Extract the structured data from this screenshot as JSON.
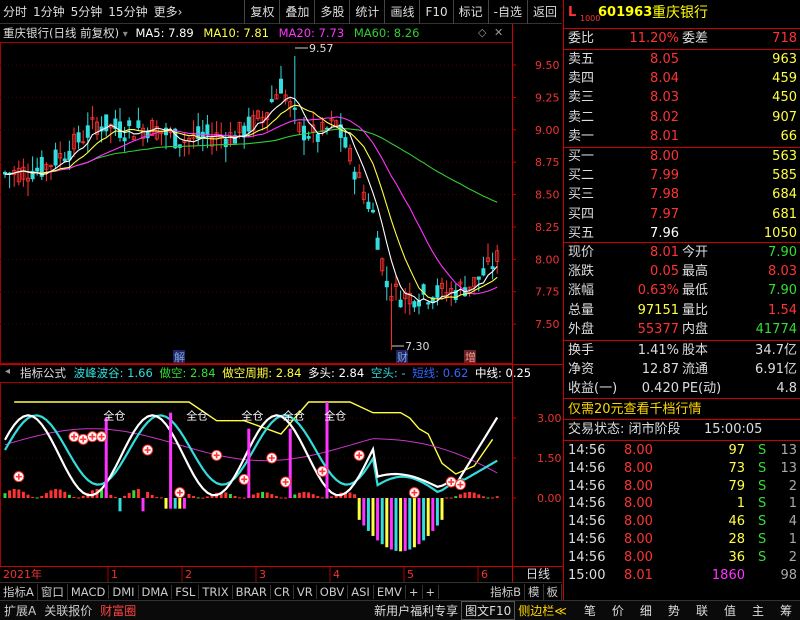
{
  "toolbar": {
    "left": [
      "分时",
      "1分钟",
      "5分钟",
      "15分钟",
      "更多›"
    ],
    "right": [
      "复权",
      "叠加",
      "多股",
      "统计",
      "画线",
      "F10",
      "标记",
      "-自选",
      "返回"
    ]
  },
  "main_legend": {
    "title": "重庆银行(日线 前复权)",
    "ma5": "MA5: 7.89",
    "ma10": "MA10: 7.81",
    "ma20": "MA20: 7.73",
    "ma60": "MA60: 8.26"
  },
  "markers": {
    "high": "9.57",
    "low": "7.30",
    "jie": "解",
    "cai": "财",
    "zeng": "增",
    "cang": "仓",
    "full_cang": "全仓"
  },
  "ind_legend": {
    "name": "指标公式",
    "p1": "波峰波谷: 1.66",
    "p2": "做空: 2.84",
    "p3": "做空周期: 2.84",
    "p4": "多头: 2.84",
    "p5": "空头: -",
    "p6": "短线: 0.62",
    "p7": "中线: 0.25"
  },
  "axis": {
    "main": [
      "9.50",
      "9.25",
      "9.00",
      "8.75",
      "8.50",
      "8.25",
      "8.00",
      "7.75",
      "7.50"
    ],
    "ind": [
      "3.00",
      "1.50",
      "0.00"
    ]
  },
  "time_axis": {
    "year": "2021年",
    "months": [
      "1",
      "2",
      "3",
      "4",
      "5",
      "6"
    ],
    "label": "日线"
  },
  "tabs": [
    "指标A",
    "窗口",
    "MACD",
    "DMI",
    "DMA",
    "FSL",
    "TRIX",
    "BRAR",
    "CR",
    "VR",
    "OBV",
    "ASI",
    "EMV",
    "+",
    "+"
  ],
  "tabs_right": [
    "指标B",
    "模",
    "板"
  ],
  "bottom_left": [
    "扩展A",
    "关联报价",
    "财富圈"
  ],
  "bottom_mid": [
    "新用户福利专享",
    "图文F10",
    "侧边栏≪"
  ],
  "bottom_right": [
    "笔",
    "价",
    "细",
    "势",
    "联",
    "值",
    "主",
    "筹"
  ],
  "stock": {
    "prefix": "L",
    "code": "601963",
    "name": "重庆银行"
  },
  "order_book": {
    "ratio": {
      "l1": "委比",
      "v1": "11.20%",
      "l2": "委差",
      "v2": "718"
    },
    "asks": [
      {
        "l": "卖五",
        "p": "8.05",
        "v": "963"
      },
      {
        "l": "卖四",
        "p": "8.04",
        "v": "459"
      },
      {
        "l": "卖三",
        "p": "8.03",
        "v": "450"
      },
      {
        "l": "卖二",
        "p": "8.02",
        "v": "907"
      },
      {
        "l": "卖一",
        "p": "8.01",
        "v": "66"
      }
    ],
    "bids": [
      {
        "l": "买一",
        "p": "8.00",
        "v": "563"
      },
      {
        "l": "买二",
        "p": "7.99",
        "v": "585"
      },
      {
        "l": "买三",
        "p": "7.98",
        "v": "684"
      },
      {
        "l": "买四",
        "p": "7.97",
        "v": "681"
      },
      {
        "l": "买五",
        "p": "7.96",
        "v": "1050"
      }
    ]
  },
  "quote": [
    {
      "l1": "现价",
      "v1": "8.01",
      "l2": "今开",
      "v2": "7.90"
    },
    {
      "l1": "涨跌",
      "v1": "0.05",
      "l2": "最高",
      "v2": "8.03"
    },
    {
      "l1": "涨幅",
      "v1": "0.63%",
      "l2": "最低",
      "v2": "7.90"
    },
    {
      "l1": "总量",
      "v1": "97151",
      "l2": "量比",
      "v2": "1.54"
    },
    {
      "l1": "外盘",
      "v1": "55377",
      "l2": "内盘",
      "v2": "41774"
    }
  ],
  "stats": [
    {
      "l1": "换手",
      "v1": "1.41%",
      "l2": "股本",
      "v2": "34.7亿"
    },
    {
      "l1": "净资",
      "v1": "12.87",
      "l2": "流通",
      "v2": "6.91亿"
    },
    {
      "l1": "收益(一)",
      "v1": "0.420",
      "l2": "PE(动)",
      "v2": "4.8"
    }
  ],
  "promo": "仅需20元查看千档行情",
  "trade_state": {
    "label": "交易状态: 闭市阶段",
    "time": "15:00:05"
  },
  "ticks": [
    {
      "t": "14:56",
      "p": "8.00",
      "v": "97",
      "s": "S",
      "n": "13"
    },
    {
      "t": "14:56",
      "p": "8.00",
      "v": "73",
      "s": "S",
      "n": "13"
    },
    {
      "t": "14:56",
      "p": "8.00",
      "v": "79",
      "s": "S",
      "n": "2"
    },
    {
      "t": "14:56",
      "p": "8.00",
      "v": "1",
      "s": "S",
      "n": "1"
    },
    {
      "t": "14:56",
      "p": "8.00",
      "v": "46",
      "s": "S",
      "n": "4"
    },
    {
      "t": "14:56",
      "p": "8.00",
      "v": "28",
      "s": "S",
      "n": "1"
    },
    {
      "t": "14:56",
      "p": "8.00",
      "v": "36",
      "s": "S",
      "n": "2"
    },
    {
      "t": "15:00",
      "p": "8.01",
      "v": "1860",
      "s": "",
      "n": "98"
    }
  ],
  "colors": {
    "red": "#ff3333",
    "green": "#33dd33",
    "yellow": "#ffff44",
    "cyan": "#33dddd",
    "magenta": "#ff33ff",
    "white": "#ffffff",
    "ma60": "#33cc33"
  }
}
